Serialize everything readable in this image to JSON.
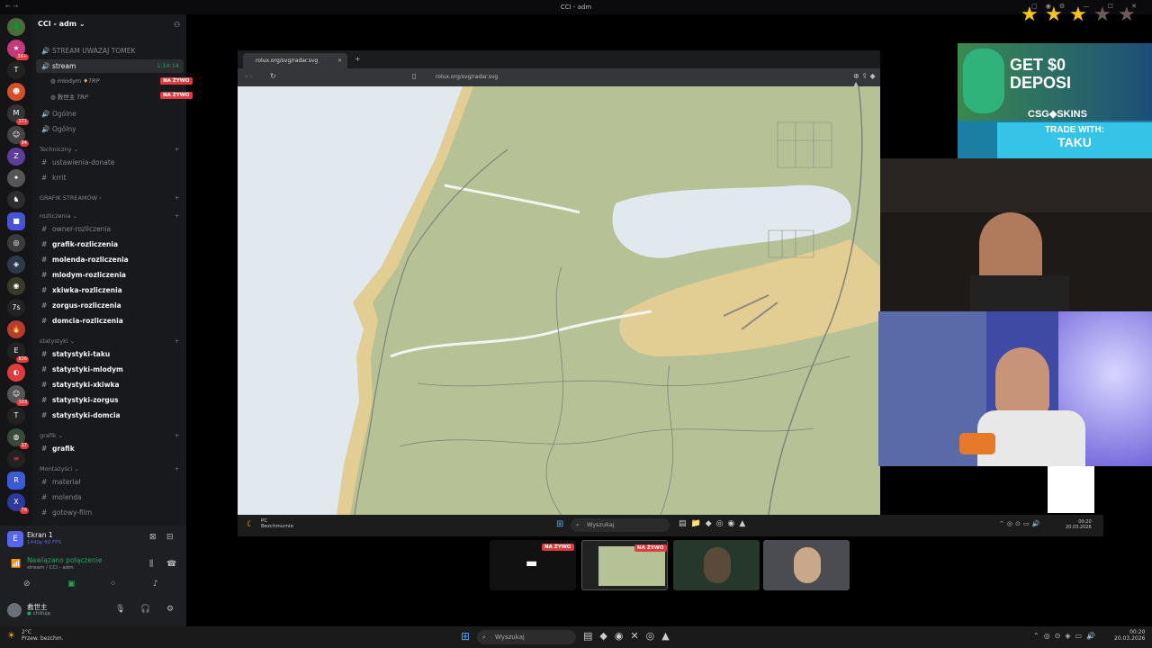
{
  "window": {
    "title": "CCI - adm"
  },
  "server": {
    "name": "CCI - adm"
  },
  "channels": {
    "stream_header": "STREAM UWAZAJ TOMEK",
    "stream": "stream",
    "stream_timer": "1:14:14",
    "voice_users": [
      {
        "name": "mlodym",
        "tag": "TRP",
        "live": "NA ŻYWO"
      },
      {
        "name": "救世主",
        "tag": "TRP",
        "live": "NA ŻYWO"
      }
    ],
    "ogolne1": "Ogólne",
    "ogolne2": "Ogólny",
    "cat_techniczny": "Techniczny",
    "ustawienia": "ustawienia-donate",
    "krrit": "krrit",
    "cat_grafik_streamow": "GRAFIK STREAMÓW",
    "cat_rozliczenia": "rozliczenia",
    "rozliczenia": [
      "owner-rozliczenia",
      "grafik-rozliczenia",
      "molenda-rozliczenia",
      "mlodym-rozliczenia",
      "xkiwka-rozliczenia",
      "zorgus-rozliczenia",
      "domcia-rozliczenia"
    ],
    "cat_statystyki": "statystyki",
    "statystyki": [
      "statystyki-taku",
      "statystyki-mlodym",
      "statystyki-xkiwka",
      "statystyki-zorgus",
      "statystyki-domcia"
    ],
    "cat_grafik": "grafik",
    "grafik": "grafik",
    "cat_montazysci": "Montażyści",
    "montaz": [
      "materiał",
      "molenda",
      "gotowy-film"
    ]
  },
  "user_panel": {
    "screen_title": "Ekran 1",
    "screen_sub": "1440p 60 FPS",
    "conn_status": "Nawiązano połączenie",
    "conn_sub": "stream / CCI - adm",
    "username": "救世主",
    "user_status": "chilluję"
  },
  "browser": {
    "tab_title": "rolux.org/svg/radar.svg",
    "url": "rolux.org/svg/radar.svg"
  },
  "inner_taskbar": {
    "weather": "PC",
    "weather_sub": "Bezchmurnie",
    "search": "Wyszukaj",
    "time": "00:20",
    "date": "20.03.2026"
  },
  "ad": {
    "line1": "GET $0",
    "line2": "DEPOSI",
    "brand": "CSG◆SKINS",
    "trade": "TRADE WITH:",
    "name": "TAKU"
  },
  "thumbs": {
    "live1": "NA ŻYWO",
    "live2": "NA ŻYWO"
  },
  "os_taskbar": {
    "weather": "2°C",
    "weather_sub": "Przew. bezchm.",
    "search": "Wyszukaj",
    "time": "00:20",
    "date": "20.03.2026"
  },
  "rating": {
    "value": 3,
    "max": 5
  },
  "colors": {
    "live_red": "#e03b3f",
    "online_green": "#23a55a",
    "map_land": "#b7c196",
    "map_water": "#dfe9ee",
    "map_sand": "#e2cd93"
  }
}
